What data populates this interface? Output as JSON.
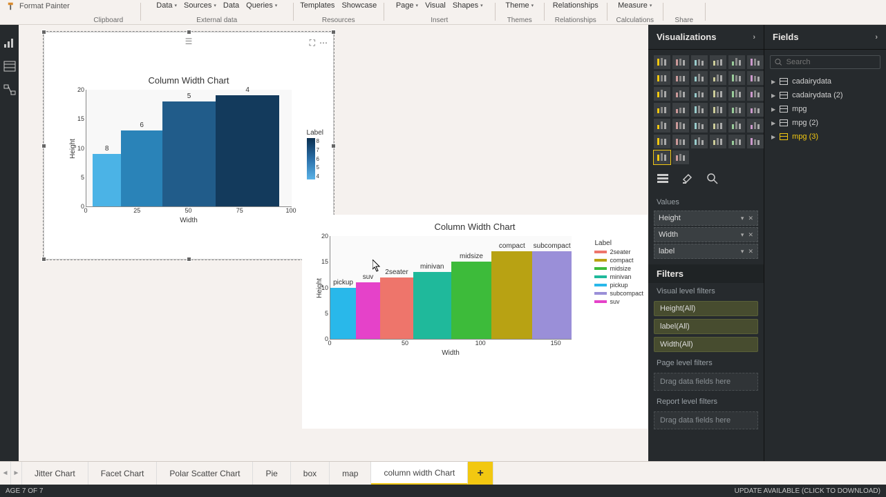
{
  "ribbon": {
    "format_painter": "Format Painter",
    "clipboard": "Clipboard",
    "data": "Data",
    "sources": "Sources",
    "data2": "Data",
    "queries": "Queries",
    "external_data": "External data",
    "templates": "Templates",
    "showcase": "Showcase",
    "resources": "Resources",
    "page": "Page",
    "visual": "Visual",
    "shapes": "Shapes",
    "insert": "Insert",
    "theme": "Theme",
    "themes": "Themes",
    "relationships": "Relationships",
    "relationships2": "Relationships",
    "measure": "Measure",
    "calculations": "Calculations",
    "share": "Share"
  },
  "chart1": {
    "title": "Column Width Chart",
    "ylabel": "Height",
    "xlabel": "Width",
    "legend_title": "Label",
    "labels": [
      "8",
      "6",
      "5",
      "4"
    ]
  },
  "chart2": {
    "title": "Column Width Chart",
    "ylabel": "Height",
    "xlabel": "Width",
    "legend_title": "Label"
  },
  "chart_data": [
    {
      "type": "bar",
      "title": "Column Width Chart",
      "xlabel": "Width",
      "ylabel": "Height",
      "xlim": [
        0,
        100
      ],
      "ylim": [
        0,
        20
      ],
      "x_ticks": [
        0,
        25,
        50,
        75,
        100
      ],
      "y_ticks": [
        0,
        5,
        10,
        15,
        20
      ],
      "bars": [
        {
          "label": 8,
          "x_start": 3,
          "width": 14,
          "height": 9,
          "color": "#4bb3e6"
        },
        {
          "label": 6,
          "x_start": 17,
          "width": 20,
          "height": 13,
          "color": "#2a83b8"
        },
        {
          "label": 5,
          "x_start": 37,
          "width": 26,
          "height": 18,
          "color": "#215c8a"
        },
        {
          "label": 4,
          "x_start": 63,
          "width": 31,
          "height": 19,
          "color": "#133a5c"
        }
      ],
      "legend": {
        "title": "Label",
        "type": "gradient",
        "min": 4,
        "max": 8
      }
    },
    {
      "type": "bar",
      "title": "Column Width Chart",
      "xlabel": "Width",
      "ylabel": "Height",
      "xlim": [
        0,
        160
      ],
      "ylim": [
        0,
        20
      ],
      "x_ticks": [
        0,
        50,
        100,
        150
      ],
      "y_ticks": [
        0,
        5,
        10,
        15,
        20
      ],
      "bars": [
        {
          "label": "pickup",
          "x_start": 0,
          "width": 17,
          "height": 10,
          "color": "#29b8ea"
        },
        {
          "label": "suv",
          "x_start": 17,
          "width": 16,
          "height": 11,
          "color": "#e542c9"
        },
        {
          "label": "2seater",
          "x_start": 33,
          "width": 22,
          "height": 12,
          "color": "#ee756b"
        },
        {
          "label": "minivan",
          "x_start": 55,
          "width": 25,
          "height": 13,
          "color": "#1fb99b"
        },
        {
          "label": "midsize",
          "x_start": 80,
          "width": 27,
          "height": 15,
          "color": "#3dbb3a"
        },
        {
          "label": "compact",
          "x_start": 107,
          "width": 27,
          "height": 17,
          "color": "#b8a213"
        },
        {
          "label": "subcompact",
          "x_start": 134,
          "width": 26,
          "height": 17,
          "color": "#9a8fd8"
        }
      ],
      "legend": {
        "title": "Label",
        "type": "categorical",
        "items": [
          {
            "name": "2seater",
            "color": "#ee756b"
          },
          {
            "name": "compact",
            "color": "#b8a213"
          },
          {
            "name": "midsize",
            "color": "#3dbb3a"
          },
          {
            "name": "minivan",
            "color": "#1fb99b"
          },
          {
            "name": "pickup",
            "color": "#29b8ea"
          },
          {
            "name": "subcompact",
            "color": "#9a8fd8"
          },
          {
            "name": "suv",
            "color": "#e542c9"
          }
        ]
      }
    }
  ],
  "viz_panel": {
    "title": "Visualizations",
    "values_label": "Values",
    "values": [
      "Height",
      "Width",
      "label"
    ],
    "filters_head": "Filters",
    "visual_filters": "Visual level filters",
    "filter_items": [
      "Height(All)",
      "label(All)",
      "Width(All)"
    ],
    "page_filters": "Page level filters",
    "report_filters": "Report level filters",
    "drag_here": "Drag data fields here"
  },
  "fields_panel": {
    "title": "Fields",
    "search_placeholder": "Search",
    "items": [
      "cadairydata",
      "cadairydata (2)",
      "mpg",
      "mpg (2)",
      "mpg (3)"
    ]
  },
  "tabs": [
    "Jitter Chart",
    "Facet Chart",
    "Polar Scatter Chart",
    "Pie",
    "box",
    "map",
    "column width Chart"
  ],
  "status": {
    "left": "AGE 7 OF 7",
    "right": "UPDATE AVAILABLE (CLICK TO DOWNLOAD)"
  }
}
